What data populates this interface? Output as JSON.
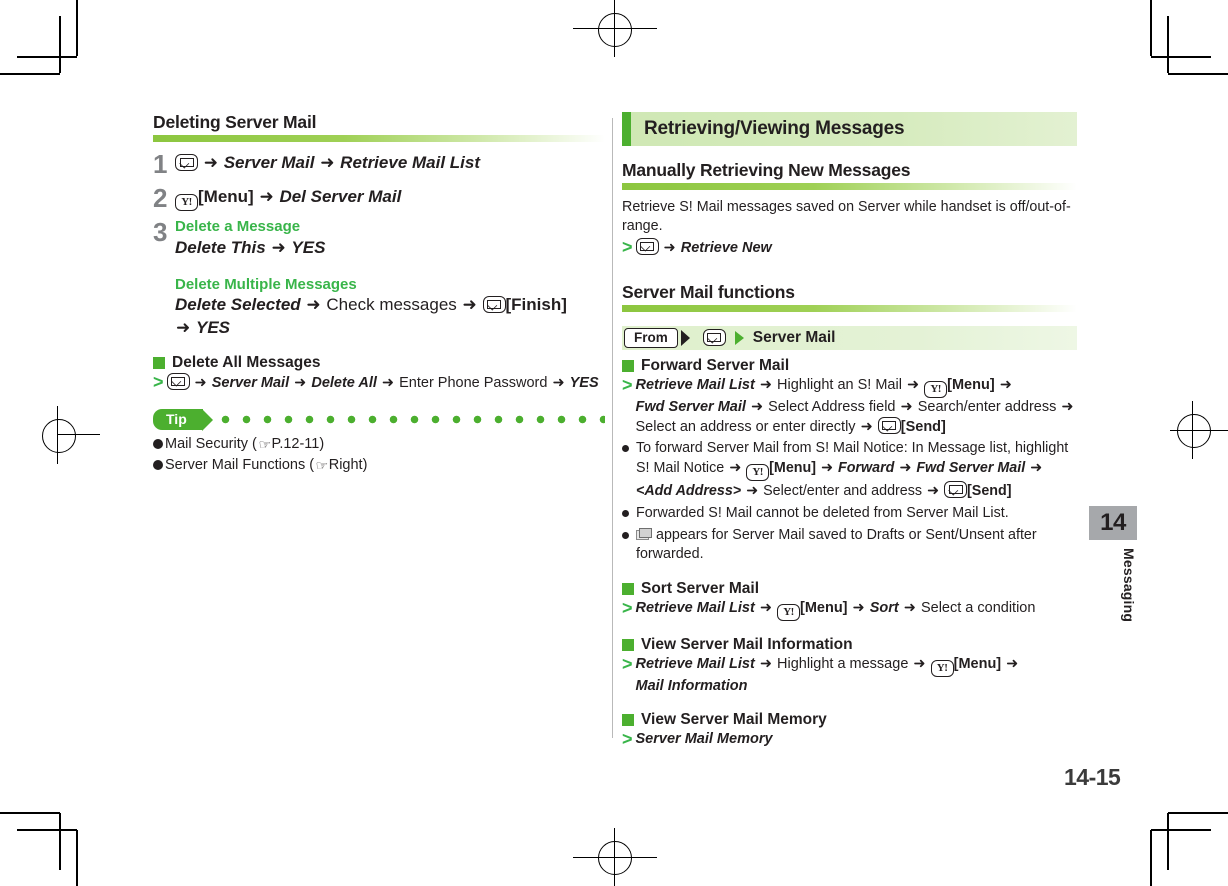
{
  "page": {
    "number": "14-15",
    "chapter_number": "14",
    "chapter_label": "Messaging"
  },
  "left_column": {
    "section_title": "Deleting Server Mail",
    "steps": [
      {
        "num": "1",
        "icon": "mail-key-icon",
        "parts": [
          {
            "text": "Server Mail",
            "style": "bold-italic"
          },
          {
            "text": "Retrieve Mail List",
            "style": "bold-italic"
          }
        ]
      },
      {
        "num": "2",
        "icon": "yahoo-key-icon",
        "key_label": "[Menu]",
        "parts": [
          {
            "text": "Del Server Mail",
            "style": "bold-italic"
          }
        ]
      },
      {
        "num": "3",
        "groups": [
          {
            "heading": "Delete a Message",
            "lines": [
              {
                "segments": [
                  {
                    "text": "Delete This",
                    "style": "bold-italic"
                  },
                  {
                    "text": "YES",
                    "style": "bold-italic"
                  }
                ]
              }
            ]
          },
          {
            "heading": "Delete Multiple Messages",
            "lines": [
              {
                "segments": [
                  {
                    "text": "Delete Selected",
                    "style": "bold-italic"
                  },
                  {
                    "text": "Check messages",
                    "style": "plain"
                  },
                  {
                    "text": "[Finish]",
                    "style": "bold",
                    "icon": "mail-key-icon"
                  },
                  {
                    "text": "YES",
                    "style": "bold-italic"
                  }
                ]
              }
            ]
          }
        ]
      }
    ],
    "delete_all": {
      "heading": "Delete All Messages",
      "steps": [
        {
          "text": "Server Mail",
          "style": "bold-italic"
        },
        {
          "text": "Delete All",
          "style": "bold-italic"
        },
        {
          "text": "Enter Phone Password",
          "style": "plain"
        },
        {
          "text": "YES",
          "style": "bold-italic"
        }
      ],
      "lead_icon": "mail-key-icon"
    },
    "tip": {
      "label": "Tip",
      "items": [
        {
          "text": "Mail Security (",
          "ref": "P.12-11",
          "close": ")"
        },
        {
          "text": "Server Mail Functions (",
          "ref": "Right",
          "close": ")"
        }
      ]
    }
  },
  "right_column": {
    "banner_title": "Retrieving/Viewing Messages",
    "manual_retrieve": {
      "title": "Manually Retrieving New Messages",
      "description": "Retrieve S! Mail messages saved on Server while handset is off/out-of-range.",
      "step_icon": "mail-key-icon",
      "step_target": "Retrieve New"
    },
    "server_mail_functions": {
      "title": "Server Mail functions",
      "from_bar": {
        "from_label": "From",
        "icon": "mail-key-icon",
        "target": "Server Mail"
      },
      "blocks": [
        {
          "heading": "Forward Server Mail",
          "gt_lines": [
            {
              "segments": [
                {
                  "text": "Retrieve Mail List",
                  "style": "bold-italic"
                },
                {
                  "text": "Highlight an S! Mail",
                  "style": "plain"
                },
                {
                  "text": "[Menu]",
                  "style": "bold",
                  "icon": "yahoo-key-icon"
                },
                {
                  "text": "Fwd Server Mail",
                  "style": "bold-italic"
                },
                {
                  "text": "Select Address field",
                  "style": "plain"
                },
                {
                  "text": "Search/enter address",
                  "style": "plain"
                },
                {
                  "text": "Select an address or enter directly",
                  "style": "plain"
                },
                {
                  "text": "[Send]",
                  "style": "bold",
                  "icon": "mail-key-icon"
                }
              ]
            }
          ],
          "bullets": [
            {
              "segments": [
                {
                  "text": "To forward Server Mail from S! Mail Notice: In Message list, highlight S! Mail Notice",
                  "style": "plain"
                },
                {
                  "text": "[Menu]",
                  "style": "bold",
                  "icon": "yahoo-key-icon"
                },
                {
                  "text": "Forward",
                  "style": "bold-italic"
                },
                {
                  "text": "Fwd Server Mail",
                  "style": "bold-italic"
                },
                {
                  "text": "<Add Address>",
                  "style": "bold-italic"
                },
                {
                  "text": "Select/enter and address",
                  "style": "plain"
                },
                {
                  "text": "[Send]",
                  "style": "bold",
                  "icon": "mail-key-icon"
                }
              ]
            },
            {
              "segments": [
                {
                  "text": "Forwarded S! Mail cannot be deleted from Server Mail List.",
                  "style": "plain"
                }
              ]
            },
            {
              "icon": "drafts-icon",
              "segments": [
                {
                  "text": "appears for Server Mail saved to Drafts or Sent/Unsent after forwarded.",
                  "style": "plain"
                }
              ]
            }
          ]
        },
        {
          "heading": "Sort Server Mail",
          "gt_lines": [
            {
              "segments": [
                {
                  "text": "Retrieve Mail List",
                  "style": "bold-italic"
                },
                {
                  "text": "[Menu]",
                  "style": "bold",
                  "icon": "yahoo-key-icon"
                },
                {
                  "text": "Sort",
                  "style": "bold-italic"
                },
                {
                  "text": "Select a condition",
                  "style": "plain"
                }
              ]
            }
          ],
          "bullets": []
        },
        {
          "heading": "View Server Mail Information",
          "gt_lines": [
            {
              "segments": [
                {
                  "text": "Retrieve Mail List",
                  "style": "bold-italic"
                },
                {
                  "text": "Highlight a message",
                  "style": "plain"
                },
                {
                  "text": "[Menu]",
                  "style": "bold",
                  "icon": "yahoo-key-icon"
                },
                {
                  "text": "Mail Information",
                  "style": "bold-italic"
                }
              ]
            }
          ],
          "bullets": []
        },
        {
          "heading": "View Server Mail Memory",
          "gt_lines": [
            {
              "segments": [
                {
                  "text": "Server Mail Memory",
                  "style": "bold-italic"
                }
              ]
            }
          ],
          "bullets": []
        }
      ]
    }
  },
  "icons": {
    "mail_key": "✉",
    "yahoo_key": "Y!",
    "arrow": "➜",
    "hand_pointer": "☞"
  },
  "colors": {
    "accent_green": "#4caf2f",
    "bright_green": "#39b54a",
    "banner_green": "#cfe8b4",
    "step_number_gray": "#808285",
    "tab_gray": "#a6a8ab"
  }
}
